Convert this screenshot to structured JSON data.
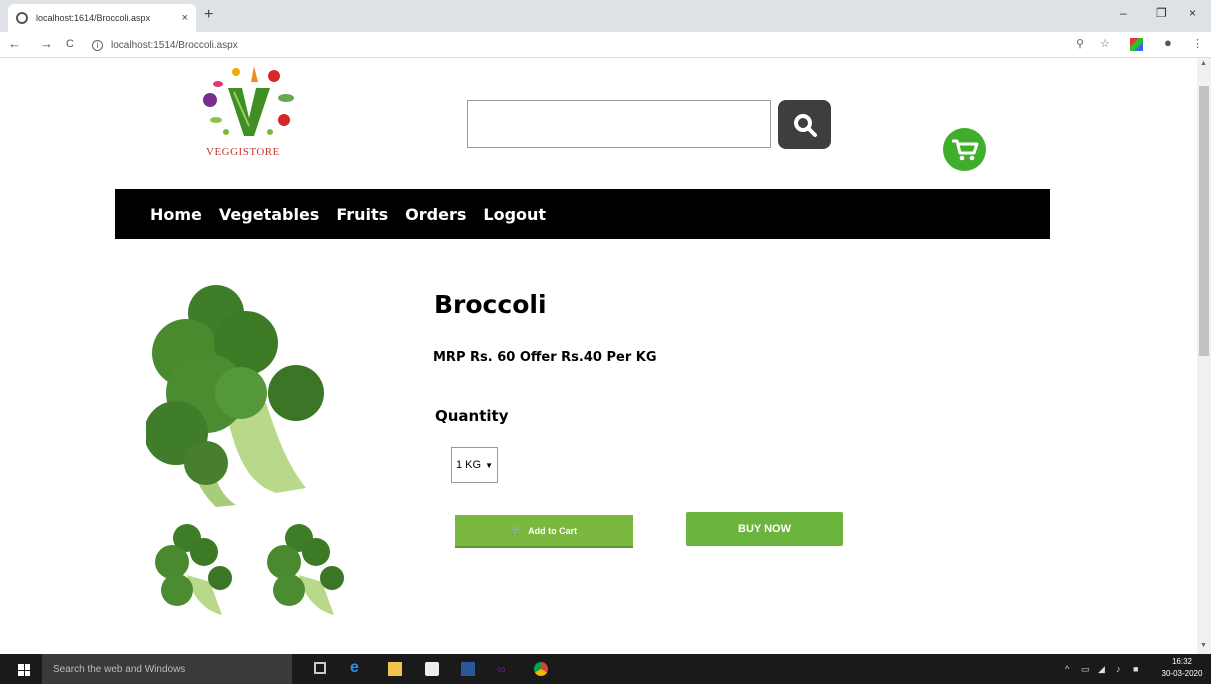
{
  "browser": {
    "tab_title": "localhost:1614/Broccoli.aspx",
    "tab_close": "×",
    "new_tab": "+",
    "url": "localhost:1514/Broccoli.aspx",
    "back": "←",
    "forward": "→",
    "reload": "C",
    "minimize": "–",
    "restore": "❐",
    "close": "×",
    "zoom_icon": "⚲",
    "star_icon": "☆",
    "menu_icon": "⋮"
  },
  "site": {
    "logo_text": "VEGGISTORE",
    "search": {
      "placeholder": ""
    },
    "nav": [
      "Home",
      "Vegetables",
      "Fruits",
      "Orders",
      "Logout"
    ]
  },
  "product": {
    "name": "Broccoli",
    "price_text": "MRP Rs. 60 Offer Rs.40 Per KG",
    "quantity_label": "Quantity",
    "quantity_selected": "1 KG",
    "add_to_cart": "Add to Cart",
    "buy_now": "BUY NOW"
  },
  "taskbar": {
    "search_placeholder": "Search the web and Windows",
    "time": "16:32",
    "date": "30-03-2020"
  },
  "colors": {
    "accent_green": "#6bb43e",
    "cart_green": "#3fae2a",
    "nav_bg": "#000000",
    "search_btn": "#3e3e3e"
  }
}
